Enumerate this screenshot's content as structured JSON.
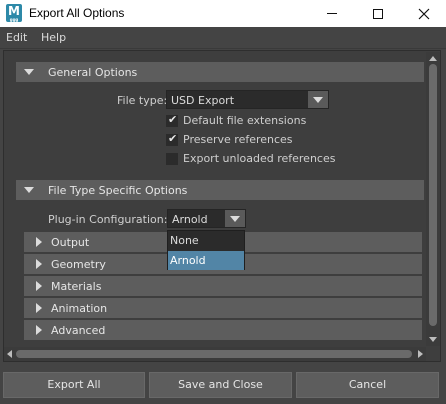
{
  "window": {
    "title": "Export All Options",
    "app_icon_letter": "M",
    "app_icon_sub": "ggg"
  },
  "menu": [
    "Edit",
    "Help"
  ],
  "general_options": {
    "header": "General Options",
    "file_type_label": "File type:",
    "file_type_value": "USD Export",
    "checkboxes": [
      {
        "label": "Default file extensions",
        "checked": true
      },
      {
        "label": "Preserve references",
        "checked": true
      },
      {
        "label": "Export unloaded references",
        "checked": false
      }
    ]
  },
  "file_type_specific": {
    "header": "File Type Specific Options",
    "plugin_config_label": "Plug-in Configuration:",
    "plugin_config_value": "Arnold",
    "dropdown_options": [
      "None",
      "Arnold"
    ],
    "dropdown_selected": "Arnold",
    "subsections": [
      "Output",
      "Geometry",
      "Materials",
      "Animation",
      "Advanced"
    ]
  },
  "buttons": {
    "export_all": "Export All",
    "save_close": "Save and Close",
    "cancel": "Cancel"
  },
  "colors": {
    "window_bg": "#444444",
    "section_header": "#5d5d5d",
    "selection": "#5285a6"
  }
}
